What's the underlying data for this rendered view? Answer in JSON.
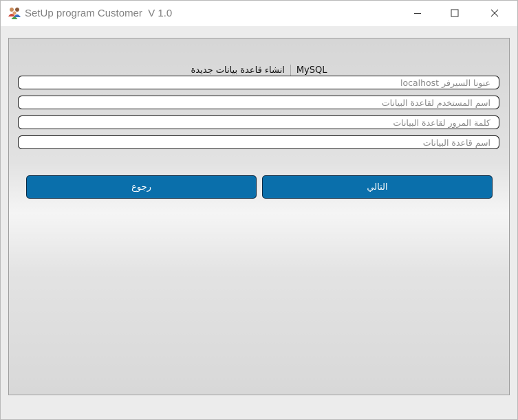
{
  "window": {
    "title": "SetUp program Customer  V 1.0"
  },
  "header": {
    "db_engine": "MySQL",
    "mode_label": "انشاء قاعدة بيانات جديدة"
  },
  "form": {
    "server_placeholder": "عنونا السيرفر localhost",
    "user_placeholder": "اسم المستخدم لقاعدة البيانات",
    "password_placeholder": "كلمة المرور لقاعدة البيانات",
    "dbname_placeholder": "اسم قاعدة البيانات"
  },
  "buttons": {
    "back_label": "رجوع",
    "next_label": "التالي"
  },
  "colors": {
    "button_bg": "#0a6fab",
    "button_text": "#ffffff"
  },
  "icons": {
    "app": "people-icon",
    "minimize": "minimize-icon",
    "maximize": "maximize-icon",
    "close": "close-icon"
  }
}
